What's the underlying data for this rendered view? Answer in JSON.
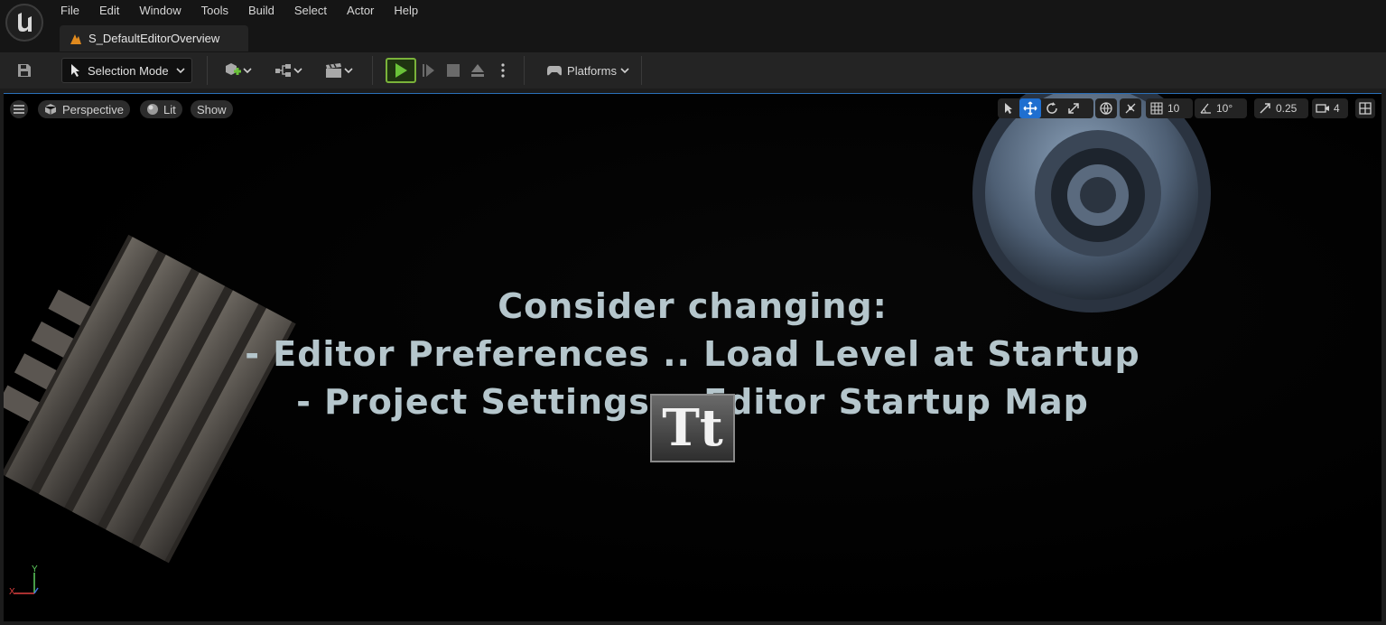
{
  "menu": [
    "File",
    "Edit",
    "Window",
    "Tools",
    "Build",
    "Select",
    "Actor",
    "Help"
  ],
  "document_tab": {
    "label": "S_DefaultEditorOverview"
  },
  "toolbar": {
    "mode_label": "Selection Mode",
    "platforms_label": "Platforms"
  },
  "viewport": {
    "view_mode": "Perspective",
    "lighting_mode": "Lit",
    "show_label": "Show",
    "grid_snap_value": "10",
    "rotation_snap_value": "10°",
    "scale_snap_value": "0.25",
    "camera_speed_value": "4",
    "message_line1": "Consider changing:",
    "message_line2": "- Editor Preferences .. Load Level at Startup",
    "message_line3": "- Project Settings .. Editor Startup Map",
    "text_actor_glyph": "Tt",
    "axis_labels": {
      "x": "X",
      "y": "Y"
    }
  },
  "colors": {
    "accent_blue": "#1f6fd0",
    "play_green": "#7ab33a",
    "message_text": "#b5c6cc"
  }
}
